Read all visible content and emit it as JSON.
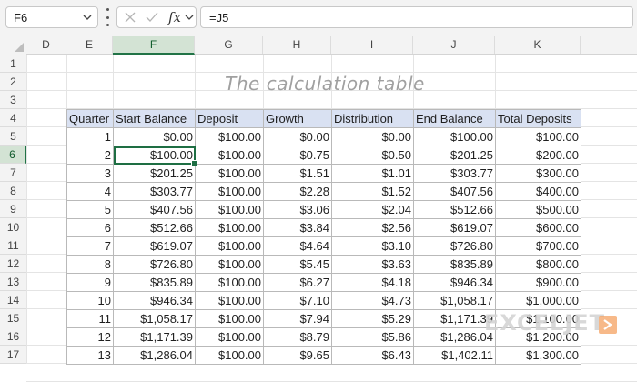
{
  "formula_bar": {
    "name_box": "F6",
    "fx_label": "fx",
    "formula": "=J5"
  },
  "columns": [
    "D",
    "E",
    "F",
    "G",
    "H",
    "I",
    "J",
    "K"
  ],
  "rows": [
    "1",
    "2",
    "3",
    "4",
    "5",
    "6",
    "7",
    "8",
    "9",
    "10",
    "11",
    "12",
    "13",
    "14",
    "15",
    "16",
    "17"
  ],
  "selected_column": "F",
  "selected_row": "6",
  "sheet": {
    "title": "The calculation table",
    "headers": [
      "Quarter",
      "Start Balance",
      "Deposit",
      "Growth",
      "Distribution",
      "End Balance",
      "Total Deposits"
    ],
    "rows": [
      [
        "1",
        "$0.00",
        "$100.00",
        "$0.00",
        "$0.00",
        "$100.00",
        "$100.00"
      ],
      [
        "2",
        "$100.00",
        "$100.00",
        "$0.75",
        "$0.50",
        "$201.25",
        "$200.00"
      ],
      [
        "3",
        "$201.25",
        "$100.00",
        "$1.51",
        "$1.01",
        "$303.77",
        "$300.00"
      ],
      [
        "4",
        "$303.77",
        "$100.00",
        "$2.28",
        "$1.52",
        "$407.56",
        "$400.00"
      ],
      [
        "5",
        "$407.56",
        "$100.00",
        "$3.06",
        "$2.04",
        "$512.66",
        "$500.00"
      ],
      [
        "6",
        "$512.66",
        "$100.00",
        "$3.84",
        "$2.56",
        "$619.07",
        "$600.00"
      ],
      [
        "7",
        "$619.07",
        "$100.00",
        "$4.64",
        "$3.10",
        "$726.80",
        "$700.00"
      ],
      [
        "8",
        "$726.80",
        "$100.00",
        "$5.45",
        "$3.63",
        "$835.89",
        "$800.00"
      ],
      [
        "9",
        "$835.89",
        "$100.00",
        "$6.27",
        "$4.18",
        "$946.34",
        "$900.00"
      ],
      [
        "10",
        "$946.34",
        "$100.00",
        "$7.10",
        "$4.73",
        "$1,058.17",
        "$1,000.00"
      ],
      [
        "11",
        "$1,058.17",
        "$100.00",
        "$7.94",
        "$5.29",
        "$1,171.39",
        "$1,100.00"
      ],
      [
        "12",
        "$1,171.39",
        "$100.00",
        "$8.79",
        "$5.86",
        "$1,286.04",
        "$1,200.00"
      ],
      [
        "13",
        "$1,286.04",
        "$100.00",
        "$9.65",
        "$6.43",
        "$1,402.11",
        "$1,300.00"
      ]
    ],
    "active_cell": {
      "row": 2,
      "col": 2
    }
  },
  "watermark": "EXCELJET",
  "colors": {
    "header_fill": "#d9e1f2",
    "selection": "#217346",
    "watermark_mark": "#f4a261"
  }
}
